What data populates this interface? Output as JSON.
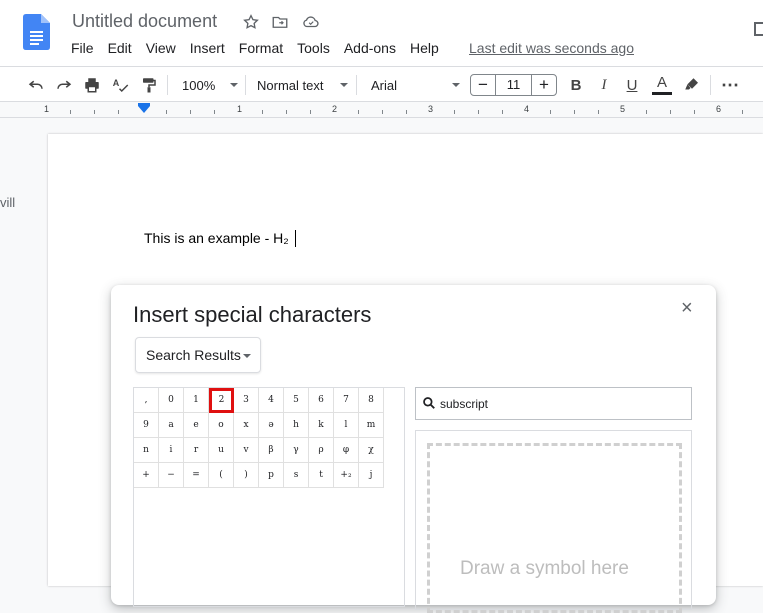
{
  "app": {
    "doc_title": "Untitled document",
    "last_edit": "Last edit was seconds ago",
    "menu": [
      "File",
      "Edit",
      "View",
      "Insert",
      "Format",
      "Tools",
      "Add-ons",
      "Help"
    ]
  },
  "toolbar": {
    "zoom": "100%",
    "style": "Normal text",
    "font": "Arial",
    "font_size": "11",
    "minus": "−",
    "plus": "+",
    "text_color": "#202124",
    "more": "⋯"
  },
  "ruler": {
    "labels": [
      "1",
      "1",
      "2",
      "3",
      "4",
      "5",
      "6"
    ]
  },
  "document": {
    "left_margin_text": "vill",
    "body_text": "This is an example - H₂"
  },
  "dialog": {
    "title": "Insert special characters",
    "close": "×",
    "category": "Search Results",
    "search_value": "subscript",
    "draw_placeholder": "Draw a symbol here",
    "grid_rows": [
      [
        ",",
        "0",
        "1",
        "2",
        "3",
        "4",
        "5",
        "6",
        "7",
        "8"
      ],
      [
        "9",
        "a",
        "e",
        "o",
        "x",
        "ə",
        "h",
        "k",
        "l",
        "m"
      ],
      [
        "n",
        "i",
        "r",
        "u",
        "v",
        "β",
        "γ",
        "ρ",
        "φ",
        "χ"
      ],
      [
        "+",
        "−",
        "=",
        "(",
        ")",
        "p",
        "s",
        "t",
        "+₂",
        "j"
      ]
    ],
    "selected_char": "2",
    "accent_color": "#e01010"
  }
}
